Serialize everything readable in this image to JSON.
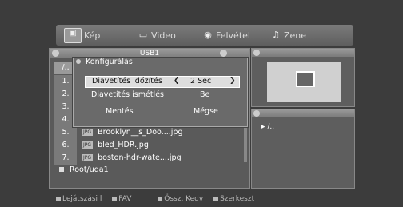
{
  "tabs": [
    {
      "label": "Kép",
      "icon": "image-icon"
    },
    {
      "label": "Video",
      "icon": "video-icon"
    },
    {
      "label": "Felvétel",
      "icon": "record-icon"
    },
    {
      "label": "Zene",
      "icon": "music-icon"
    }
  ],
  "panel_title": "USB1",
  "file_list": [
    {
      "num": "/..",
      "name": ""
    },
    {
      "num": "1.",
      "name": ""
    },
    {
      "num": "2.",
      "name": ""
    },
    {
      "num": "3.",
      "name": ""
    },
    {
      "num": "4.",
      "name": ""
    },
    {
      "num": "5.",
      "name": "Brooklyn__s_Doo....jpg"
    },
    {
      "num": "6.",
      "name": "bled_HDR.jpg"
    },
    {
      "num": "7.",
      "name": "boston-hdr-wate....jpg"
    }
  ],
  "file_badge": "JPG",
  "current_path": "Root/uda1",
  "dialog": {
    "title": "Konfigurálás",
    "setting1_label": "Diavetítés időzítés",
    "setting1_value": "2 Sec",
    "setting2_label": "Diavetítés ismétlés",
    "setting2_value": "Be",
    "save_label": "Mentés",
    "cancel_label": "Mégse"
  },
  "preview_parent": "/..",
  "bottom_bar": {
    "item1": "Lejátszási l",
    "item2": "FAV",
    "item3": "Össz. Kedv",
    "item4": "Szerkeszt"
  }
}
